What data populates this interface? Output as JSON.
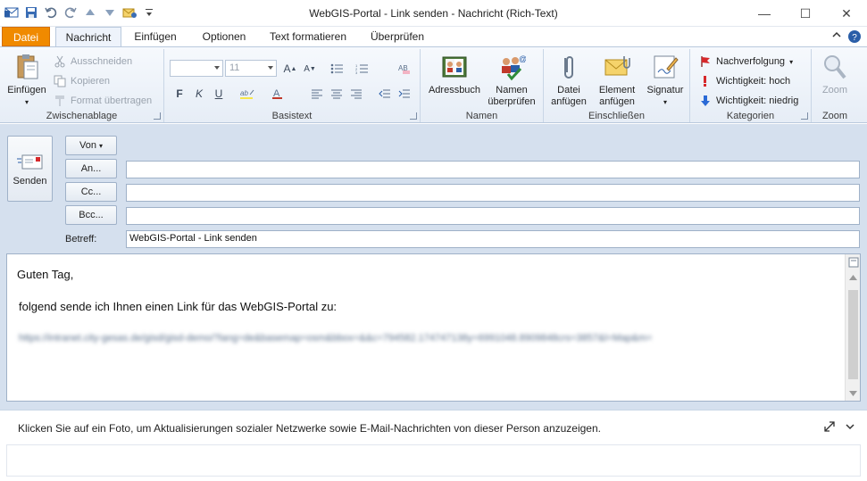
{
  "window": {
    "title": "WebGIS-Portal        - Link senden  -  Nachricht (Rich-Text)",
    "controls": {
      "minimize": "—",
      "maximize": "☐",
      "close": "✕"
    }
  },
  "tabs": [
    {
      "label": "Datei"
    },
    {
      "label": "Nachricht"
    },
    {
      "label": "Einfügen"
    },
    {
      "label": "Optionen"
    },
    {
      "label": "Text formatieren"
    },
    {
      "label": "Überprüfen"
    }
  ],
  "ribbon": {
    "clipboard": {
      "label": "Zwischenablage",
      "paste": "Einfügen",
      "cut": "Ausschneiden",
      "copy": "Kopieren",
      "format_painter": "Format übertragen"
    },
    "basic_text": {
      "label": "Basistext",
      "font_size": "11",
      "bold": "F",
      "italic": "K",
      "underline": "U"
    },
    "names": {
      "label": "Namen",
      "address_book": "Adressbuch",
      "check_names_line1": "Namen",
      "check_names_line2": "überprüfen"
    },
    "include": {
      "label": "Einschließen",
      "attach_file_line1": "Datei",
      "attach_file_line2": "anfügen",
      "attach_item_line1": "Element",
      "attach_item_line2": "anfügen",
      "signature": "Signatur"
    },
    "tags": {
      "label": "Kategorien",
      "follow_up": "Nachverfolgung",
      "high_importance": "Wichtigkeit: hoch",
      "low_importance": "Wichtigkeit: niedrig"
    },
    "zoom": {
      "label": "Zoom",
      "zoom": "Zoom"
    }
  },
  "compose": {
    "send": "Senden",
    "from": "Von",
    "to": "An...",
    "cc": "Cc...",
    "bcc": "Bcc...",
    "subject_label": "Betreff:",
    "to_value": "",
    "cc_value": "",
    "bcc_value": "",
    "subject_value": "WebGIS-Portal  - Link senden"
  },
  "body": {
    "greeting": "Guten Tag,",
    "line1": "folgend sende ich Ihnen einen Link für das WebGIS-Portal  zu:",
    "link": "https://intranet.city-gesas.de/gisd/gisd-demo/?lang=de&basemap=osm&bbox=&&c=794582.174747138y=6991048.8909848crs=3857&l=Map&m="
  },
  "people_pane": {
    "text": "Klicken Sie auf ein Foto, um Aktualisierungen sozialer Netzwerke sowie E-Mail-Nachrichten von dieser Person anzuzeigen."
  }
}
